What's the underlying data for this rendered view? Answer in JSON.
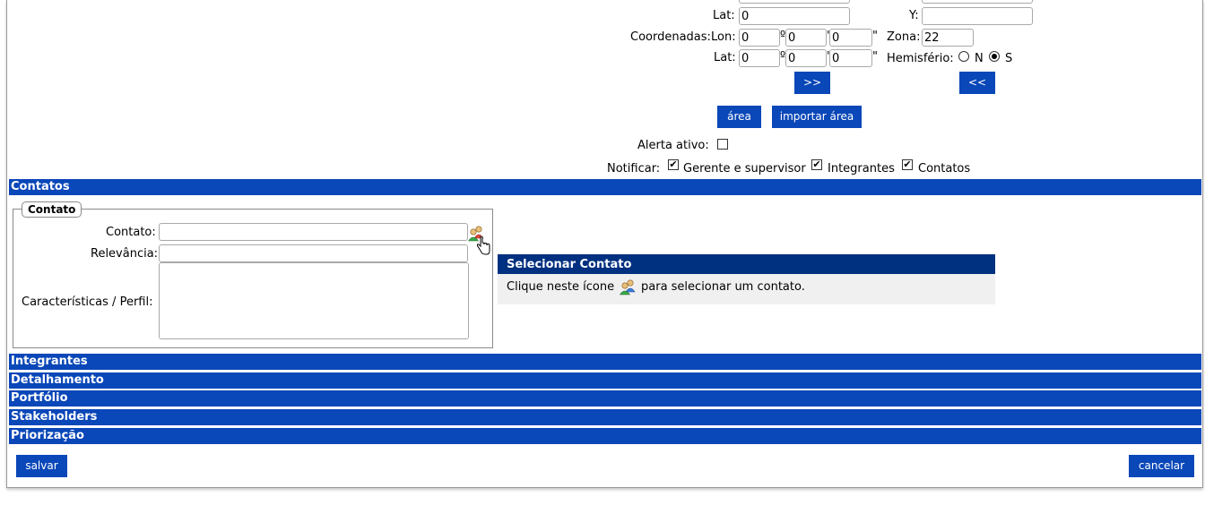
{
  "coords": {
    "lat_label": "Lat:",
    "lat_value": "0",
    "y_label": "Y:",
    "y_value": "",
    "coordenadas_label": "Coordenadas:",
    "lon_label": "Lon:",
    "lon_deg": "0",
    "lon_min": "0",
    "lon_sec": "0",
    "lat2_label": "Lat:",
    "lat2_deg": "0",
    "lat2_min": "0",
    "lat2_sec": "0",
    "deg_symbol": "º",
    "min_symbol": "'",
    "sec_symbol": "\"",
    "zona_label": "Zona:",
    "zona_value": "22",
    "hemisferio_label": "Hemisfério:",
    "hemisferio_n": "N",
    "hemisferio_s": "S",
    "forward_btn": ">>",
    "back_btn": "<<"
  },
  "area": {
    "area_btn": "área",
    "import_btn": "importar área"
  },
  "alerts": {
    "alerta_label": "Alerta ativo:",
    "notificar_label": "Notificar:",
    "gerente_label": "Gerente e supervisor",
    "integrantes_label": "Integrantes",
    "contatos_label": "Contatos",
    "check_mark": "✔"
  },
  "sections": {
    "contatos": "Contatos",
    "integrantes": "Integrantes",
    "detalhamento": "Detalhamento",
    "portfolio": "Portfólio",
    "stakeholders": "Stakeholders",
    "priorizacao": "Priorização"
  },
  "contato_form": {
    "legend": "Contato",
    "contato_label": "Contato:",
    "contato_value": "",
    "relevancia_label": "Relevância:",
    "relevancia_value": "",
    "caracteristicas_label": "Características / Perfil:",
    "caracteristicas_value": ""
  },
  "tooltip": {
    "title": "Selecionar Contato",
    "text_before": "Clique neste ícone",
    "text_after": "para selecionar um contato."
  },
  "footer": {
    "save_btn": "salvar",
    "cancel_btn": "cancelar"
  },
  "colors": {
    "primary_blue": "#0a47b8",
    "dark_blue": "#003080",
    "tooltip_bg": "#f0f0f0"
  }
}
